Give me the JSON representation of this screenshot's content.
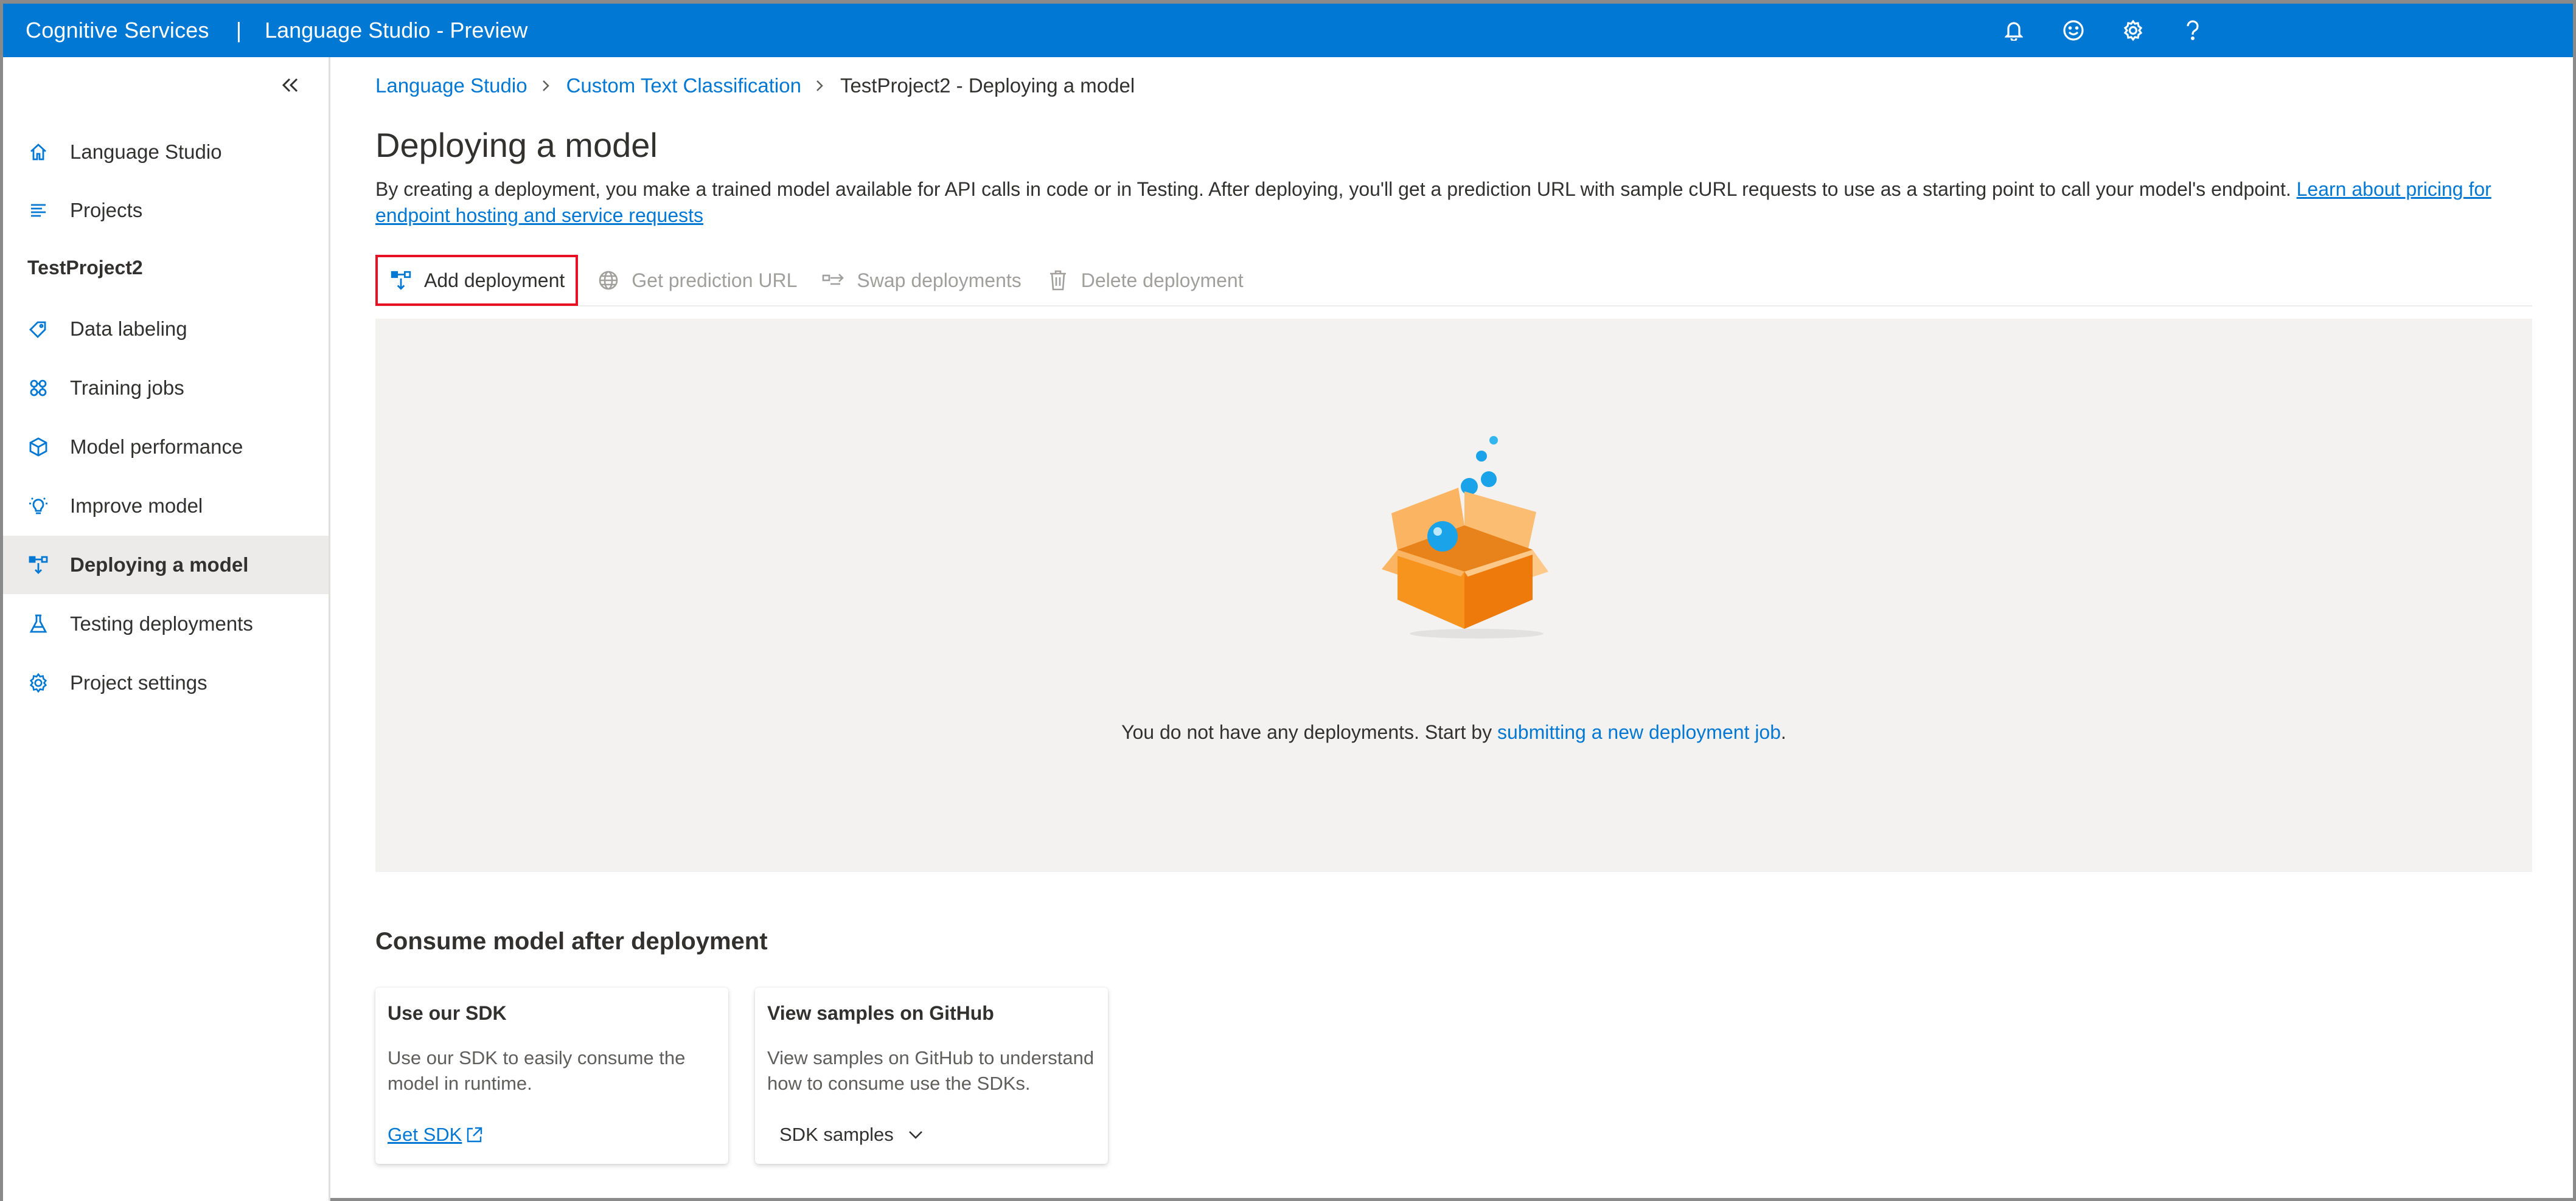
{
  "header": {
    "brand": "Cognitive Services",
    "separator": "|",
    "product": "Language Studio - Preview",
    "icons": [
      "bell-icon",
      "smiley-icon",
      "gear-icon",
      "help-icon"
    ]
  },
  "sidebar": {
    "collapse_icon": "double-chevron-left-icon",
    "top_items": [
      {
        "label": "Language Studio",
        "icon": "home-icon"
      },
      {
        "label": "Projects",
        "icon": "list-icon"
      }
    ],
    "project_name": "TestProject2",
    "project_items": [
      {
        "label": "Data labeling",
        "icon": "tag-icon"
      },
      {
        "label": "Training jobs",
        "icon": "brain-icon"
      },
      {
        "label": "Model performance",
        "icon": "cube-icon"
      },
      {
        "label": "Improve model",
        "icon": "lightbulb-icon"
      },
      {
        "label": "Deploying a model",
        "icon": "deploy-icon",
        "active": true
      },
      {
        "label": "Testing deployments",
        "icon": "flask-icon"
      },
      {
        "label": "Project settings",
        "icon": "gear-icon"
      }
    ]
  },
  "breadcrumb": [
    "Language Studio",
    "Custom Text Classification",
    "TestProject2 - Deploying a model"
  ],
  "page": {
    "title": "Deploying a model",
    "description": "By creating a deployment, you make a trained model available for API calls in code or in Testing. After deploying, you'll get a prediction URL with sample cURL requests to use as a starting point to call your model's endpoint.",
    "description_link": "Learn about pricing for endpoint hosting and service requests"
  },
  "toolbar": {
    "add": "Add deployment",
    "get_url": "Get prediction URL",
    "swap": "Swap deployments",
    "delete": "Delete deployment"
  },
  "empty_state": {
    "message_prefix": "You do not have any deployments. Start by ",
    "message_link": "submitting a new deployment job",
    "message_suffix": "."
  },
  "consume": {
    "title": "Consume model after deployment",
    "cards": [
      {
        "title": "Use our SDK",
        "description": "Use our SDK to easily consume the model in runtime.",
        "action": "Get SDK"
      },
      {
        "title": "View samples on GitHub",
        "description": "View samples on GitHub to understand how to consume use the SDKs.",
        "action": "SDK samples"
      }
    ]
  },
  "colors": {
    "accent": "#0078d4",
    "highlight_border": "#e81123",
    "box_orange": "#f7941d",
    "bubble_blue": "#1aa3e8"
  }
}
